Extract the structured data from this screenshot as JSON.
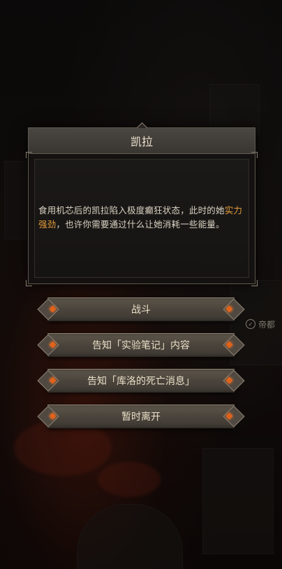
{
  "dialog": {
    "title": "凯拉",
    "text_before": "食用机芯后的凯拉陷入极度癫狂状态，此时的她",
    "text_highlight": "实力强劲",
    "text_after": "，也许你需要通过什么让她消耗一些能量。"
  },
  "options": [
    {
      "label": "战斗"
    },
    {
      "label": "告知「实验笔记」内容"
    },
    {
      "label": "告知「库洛的死亡消息」"
    },
    {
      "label": "暂时离开"
    }
  ],
  "side_tag": {
    "label": "帝都"
  },
  "colors": {
    "highlight": "#e39a3c",
    "gem": "#e0631c"
  }
}
